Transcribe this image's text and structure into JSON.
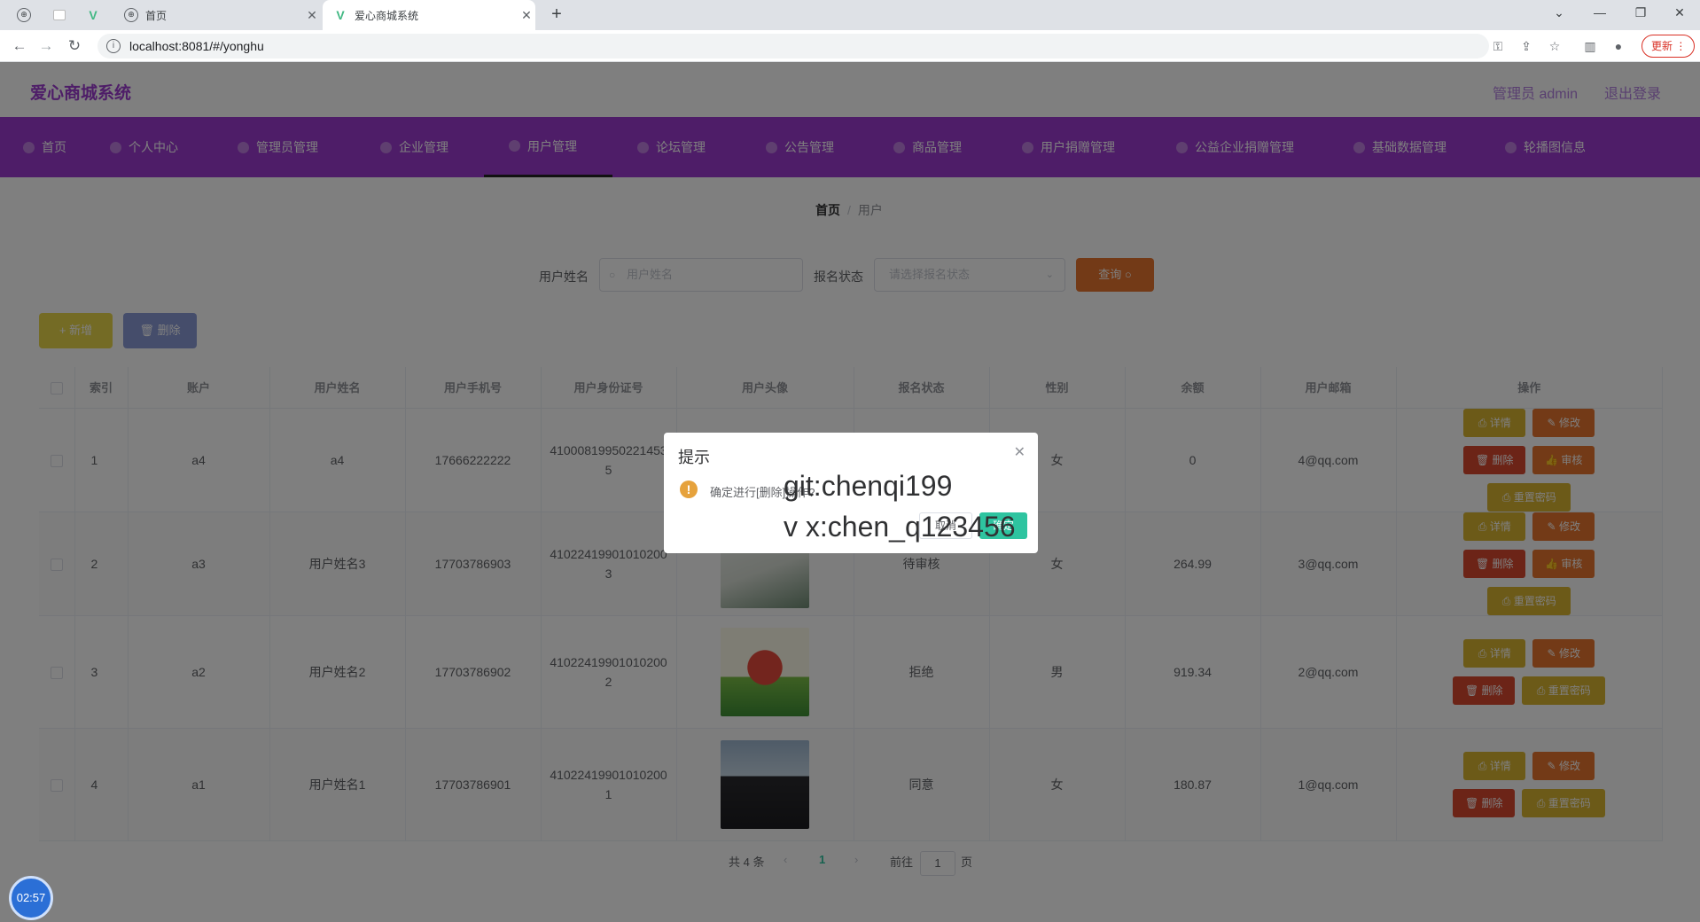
{
  "browser": {
    "tabs": [
      {
        "title": "首页",
        "icon": "globe-icon"
      },
      {
        "title": "爱心商城系统",
        "icon": "vue-logo-icon"
      }
    ],
    "url": "localhost:8081/#/yonghu",
    "update_label": "更新"
  },
  "header": {
    "brand": "爱心商城系统",
    "admin_label": "管理员 admin",
    "logout_label": "退出登录"
  },
  "menu": {
    "items": [
      "首页",
      "个人中心",
      "管理员管理",
      "企业管理",
      "用户管理",
      "论坛管理",
      "公告管理",
      "商品管理",
      "用户捐赠管理",
      "公益企业捐赠管理",
      "基础数据管理",
      "轮播图信息"
    ],
    "active_index": 4
  },
  "breadcrumb": {
    "home": "首页",
    "current": "用户"
  },
  "search": {
    "name_label": "用户姓名",
    "name_placeholder": "用户姓名",
    "status_label": "报名状态",
    "status_placeholder": "请选择报名状态",
    "query_label": "查询"
  },
  "actions": {
    "add_label": "+ 新增",
    "delete_label": "删除"
  },
  "table": {
    "headers": [
      "索引",
      "账户",
      "用户姓名",
      "用户手机号",
      "用户身份证号",
      "用户头像",
      "报名状态",
      "性别",
      "余额",
      "用户邮箱",
      "操作"
    ],
    "rows": [
      {
        "index": "1",
        "account": "a4",
        "name": "a4",
        "phone": "17666222222",
        "id_card": "410008199502214535",
        "status": "",
        "gender": "女",
        "balance": "0",
        "email": "4@qq.com"
      },
      {
        "index": "2",
        "account": "a3",
        "name": "用户姓名3",
        "phone": "17703786903",
        "id_card": "410224199010102003",
        "status": "待审核",
        "gender": "女",
        "balance": "264.99",
        "email": "3@qq.com"
      },
      {
        "index": "3",
        "account": "a2",
        "name": "用户姓名2",
        "phone": "17703786902",
        "id_card": "410224199010102002",
        "status": "拒绝",
        "gender": "男",
        "balance": "919.34",
        "email": "2@qq.com"
      },
      {
        "index": "4",
        "account": "a1",
        "name": "用户姓名1",
        "phone": "17703786901",
        "id_card": "410224199010102001",
        "status": "同意",
        "gender": "女",
        "balance": "180.87",
        "email": "1@qq.com"
      }
    ],
    "op_labels": {
      "detail": "详情",
      "edit": "修改",
      "delete": "删除",
      "audit": "审核",
      "reset": "重置密码"
    }
  },
  "pagination": {
    "total": "共 4 条",
    "page": "1",
    "goto_label": "前往",
    "goto_value": "1",
    "page_suffix": "页"
  },
  "dialog": {
    "title": "提示",
    "message": "确定进行[删除]操作?",
    "cancel_label": "取消",
    "confirm_label": "确定"
  },
  "watermark": {
    "line1": "git:chenqi199",
    "line2": "v x:chen_q123456"
  },
  "timer": "02:57"
}
